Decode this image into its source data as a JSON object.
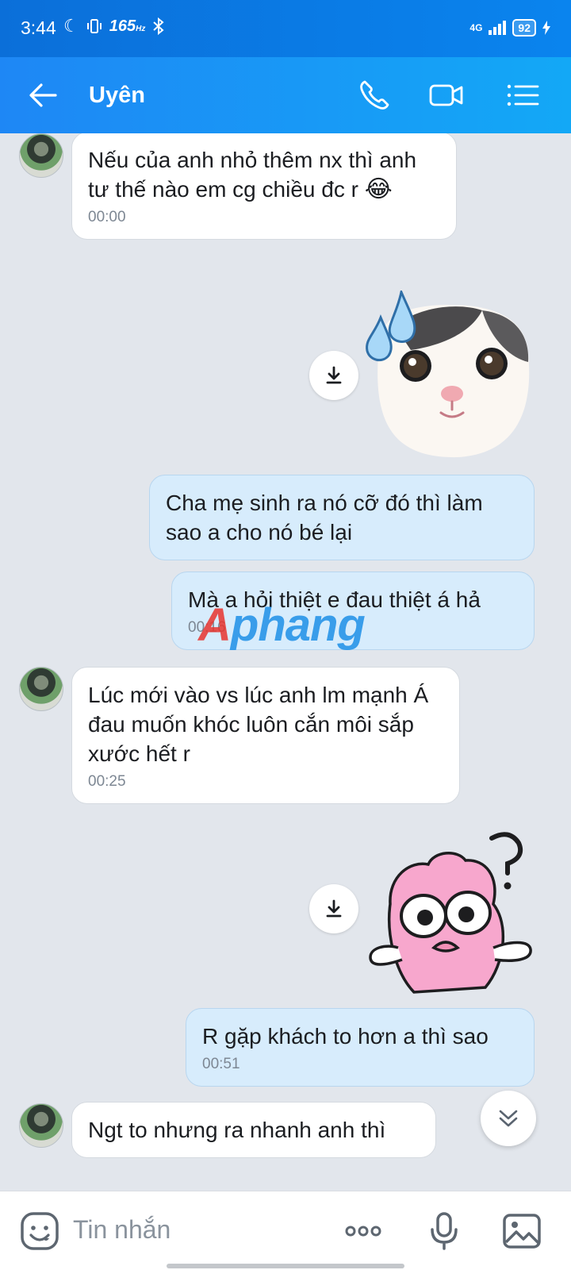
{
  "status_bar": {
    "time": "3:44",
    "refresh": "165",
    "refresh_unit": "Hz",
    "network": "4G",
    "battery": "92"
  },
  "header": {
    "contact_name": "Uyên"
  },
  "messages": [
    {
      "text": "Nếu của anh nhỏ thêm nx thì anh tư thế nào em cg chiều đc r",
      "emoji": "😂",
      "time": "00:00"
    },
    {
      "text": "Cha mẹ sinh ra nó cỡ đó thì làm sao a cho nó bé lại"
    },
    {
      "text": "Mà a hỏi thiệt e đau thiệt á hả",
      "time": "00:16"
    },
    {
      "text": "Lúc mới vào vs lúc anh lm mạnh Á đau muốn khóc luôn cắn môi sắp xước hết r",
      "time": "00:25"
    },
    {
      "text": "R gặp khách to hơn a thì sao",
      "time": "00:51"
    },
    {
      "text": "Ngt to nhưng ra nhanh anh thì"
    }
  ],
  "watermark": {
    "first": "A",
    "rest": "phang"
  },
  "input": {
    "placeholder": "Tin nhắn"
  }
}
